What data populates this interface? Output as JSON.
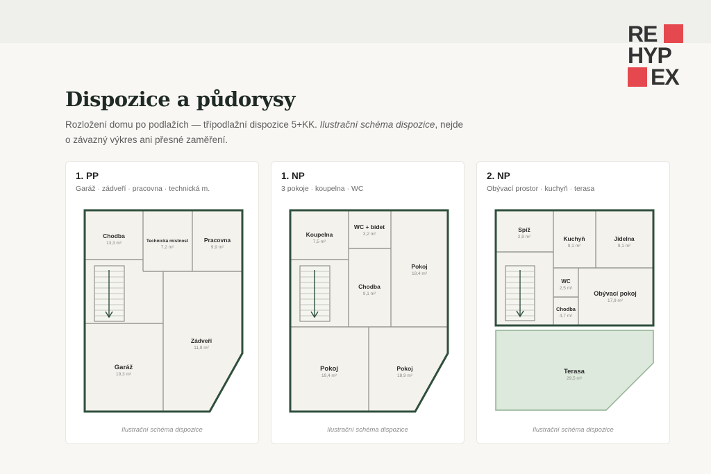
{
  "brand": {
    "logo_lines": [
      "RE",
      "HYP",
      "EX"
    ],
    "accent": "#e5494f"
  },
  "page": {
    "title": "Dispozice a půdorysy",
    "subtitle_plain": "Rozložení domu po podlažích — třípodlažní dispozice 5+KK.",
    "subtitle_italic": "Ilustrační schéma dispozice",
    "subtitle_rest": ", nejde o závazný výkres ani přesné zaměření."
  },
  "floors": [
    {
      "name": "1. PP",
      "summary": "Garáž · zádveří · pracovna · technická m.",
      "caption": "Ilustrační schéma dispozice",
      "rooms": [
        {
          "name": "Chodba",
          "area": "13,3 m²"
        },
        {
          "name": "Technická místnost",
          "area": "7,2 m²"
        },
        {
          "name": "Pracovna",
          "area": "9,9 m²"
        },
        {
          "name": "Zádveří",
          "area": "11,9 m²"
        },
        {
          "name": "Garáž",
          "area": "19,3 m²"
        }
      ]
    },
    {
      "name": "1. NP",
      "summary": "3 pokoje · koupelna · WC",
      "caption": "Ilustrační schéma dispozice",
      "rooms": [
        {
          "name": "Koupelna",
          "area": "7,5 m²"
        },
        {
          "name": "WC + bidet",
          "area": "3,2 m²"
        },
        {
          "name": "Chodba",
          "area": "9,1 m²"
        },
        {
          "name": "Pokoj",
          "area": "18,4 m²"
        },
        {
          "name": "Pokoj",
          "area": "19,4 m²"
        },
        {
          "name": "Pokoj",
          "area": "18,9 m²"
        }
      ]
    },
    {
      "name": "2. NP",
      "summary": "Obývací prostor · kuchyň · terasa",
      "caption": "Ilustrační schéma dispozice",
      "rooms": [
        {
          "name": "Spíž",
          "area": "2,9 m²"
        },
        {
          "name": "Kuchyň",
          "area": "9,1 m²"
        },
        {
          "name": "Jídelna",
          "area": "9,1 m²"
        },
        {
          "name": "WC",
          "area": "2,5 m²"
        },
        {
          "name": "Obývací pokoj",
          "area": "17,9 m²"
        },
        {
          "name": "Chodba",
          "area": "4,7 m²"
        },
        {
          "name": "Terasa",
          "area": "29,5 m²"
        }
      ]
    }
  ],
  "colors": {
    "wall": "#2f4f3c",
    "room_fill": "#f3f2ec",
    "terrace_fill": "#dde9dc",
    "divider": "#9a9a93"
  }
}
